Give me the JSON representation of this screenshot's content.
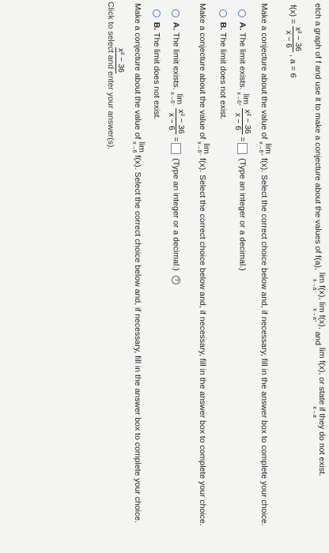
{
  "intro": "etch a graph of f and use it to make a conjecture about the values of f(a),",
  "intro_lims": [
    "lim f(x),",
    "lim f(x),",
    "and",
    "lim f(x), or state if they do not exist."
  ],
  "intro_subs": [
    "x→a⁻",
    "x→a⁺",
    "x→a"
  ],
  "func": {
    "lhs": "f(x) =",
    "num": "x² − 36",
    "den": "x − 6",
    "rest": ", a = 6"
  },
  "q1": {
    "prompt": "Make a conjecture about the value of",
    "lim_word": "lim",
    "lim_sub": "x→6⁺",
    "after": "f(x). Select the correct choice below and, if necessary, fill in the answer box to complete your choice.",
    "optA_letter": "A.",
    "optA_text": "The limit exists.",
    "optA_lim_sub": "x→6⁺",
    "optA_num": "x² − 36",
    "optA_den": "x − 6",
    "optA_hint": "(Type an integer or a decimal.)",
    "optB_letter": "B.",
    "optB_text": "The limit does not exist."
  },
  "q2": {
    "prompt": "Make a conjecture about the value of",
    "lim_word": "lim",
    "lim_sub": "x→6⁻",
    "after": "f(x). Select the correct choice below and, if necessary, fill in the answer box to complete your choice.",
    "optA_letter": "A.",
    "optA_text": "The limit exists.",
    "optA_lim_sub": "x→6⁻",
    "optA_num": "x² − 36",
    "optA_den": "x − 6",
    "optA_hint": "(Type an integer or a decimal.)",
    "optB_letter": "B.",
    "optB_text": "The limit does not exist."
  },
  "q3": {
    "prompt": "Make a conjecture about the value of",
    "lim_word": "lim",
    "lim_sub": "x→6",
    "after": "f(x). Select the correct choice below and, if necessary, fill in the answer box to complete your choice.",
    "num": "x² − 36"
  },
  "footer": "Click to select and enter your answer(s)."
}
